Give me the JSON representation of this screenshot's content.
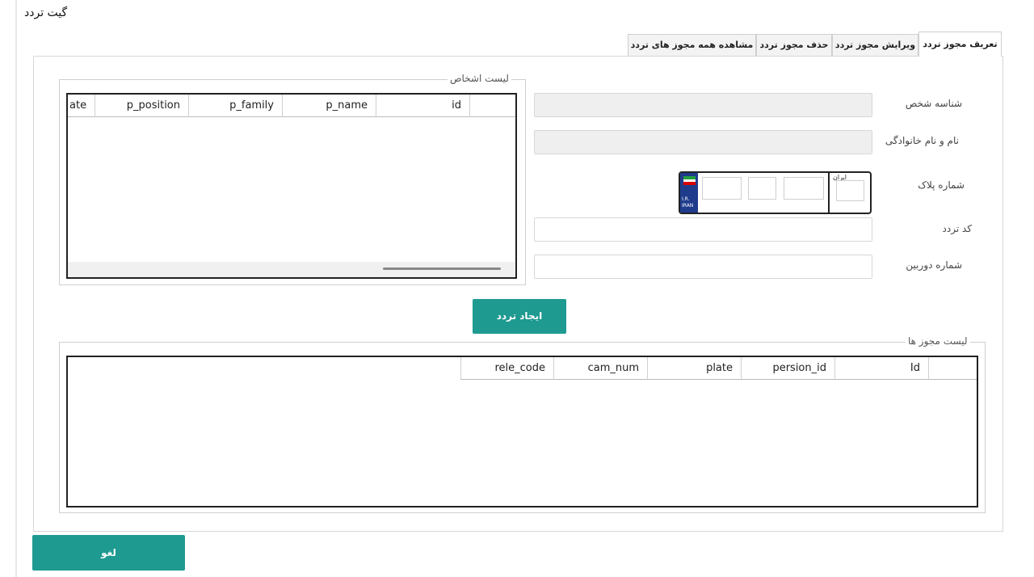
{
  "window": {
    "title": "گیت تردد"
  },
  "tabs": [
    {
      "label": "تعریف مجوز تردد",
      "active": true
    },
    {
      "label": "ویرایش مجوز تردد",
      "active": false
    },
    {
      "label": "حذف مجوز تردد",
      "active": false
    },
    {
      "label": "مشاهده همه مجوز های تردد",
      "active": false
    }
  ],
  "form": {
    "person_id_label": "شناسه شخص",
    "person_id_value": "",
    "full_name_label": "نام و نام خانوادگی",
    "full_name_value": "",
    "plate_label": "شماره پلاک",
    "plate": {
      "country_line1": "I.R.",
      "country_line2": "IRAN",
      "region_label": "ایران",
      "part1": "",
      "letter": "",
      "part2": "",
      "region_code": ""
    },
    "traffic_code_label": "کد تردد",
    "traffic_code_value": "",
    "camera_number_label": "شماره دوربین",
    "camera_number_value": ""
  },
  "persons_list": {
    "title": "لیست اشخاص",
    "columns": [
      "ate",
      "p_position",
      "p_family",
      "p_name",
      "id"
    ],
    "rows": []
  },
  "create_button": {
    "label": "ایجاد تردد"
  },
  "permits_list": {
    "title": "لیست مجوز ها",
    "columns": [
      "rele_code",
      "cam_num",
      "plate",
      "persion_id",
      "Id"
    ],
    "rows": []
  },
  "cancel_button": {
    "label": "لغو"
  },
  "colors": {
    "accent": "#1e9a90",
    "readonly_field": "#efefef",
    "plate_blue": "#1f3c8c"
  },
  "icons": [
    "iran-flag-icon"
  ]
}
